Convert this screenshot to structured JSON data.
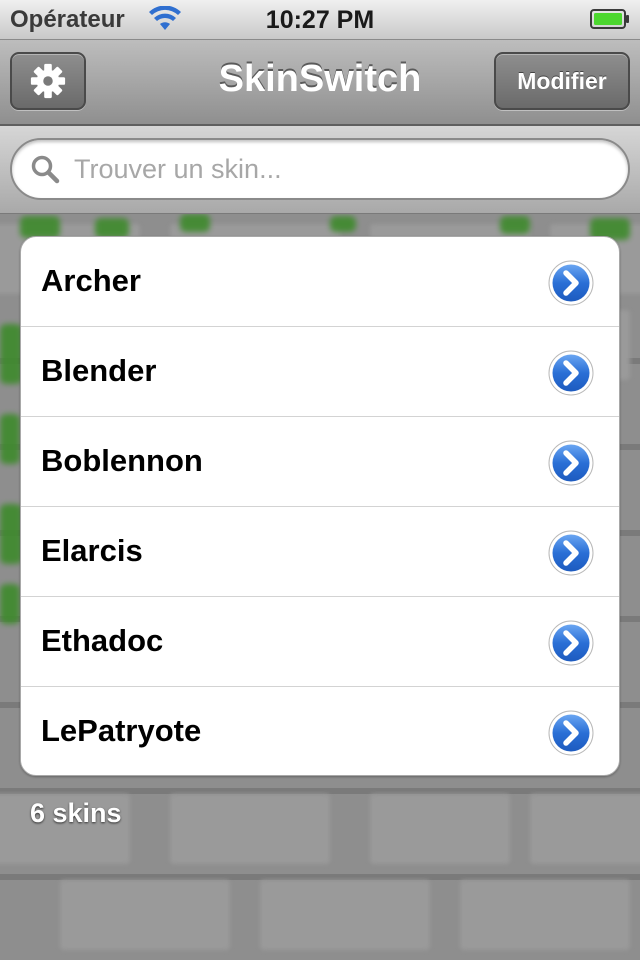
{
  "status_bar": {
    "carrier": "Opérateur",
    "time": "10:27 PM",
    "wifi_icon": "wifi-icon",
    "battery_icon": "battery-icon",
    "battery_color": "#4cd72f"
  },
  "nav_bar": {
    "title": "SkinSwitch",
    "left_button_icon": "gear-icon",
    "right_button_label": "Modifier"
  },
  "search": {
    "placeholder": "Trouver un skin...",
    "value": ""
  },
  "skins": {
    "items": [
      {
        "name": "Archer"
      },
      {
        "name": "Blender"
      },
      {
        "name": "Boblennon"
      },
      {
        "name": "Elarcis"
      },
      {
        "name": "Ethadoc"
      },
      {
        "name": "LePatryote"
      }
    ],
    "accessory_icon": "chevron-right-circle-icon",
    "accessory_color": "#2a6fd6"
  },
  "footer": {
    "count_label": "6 skins"
  }
}
